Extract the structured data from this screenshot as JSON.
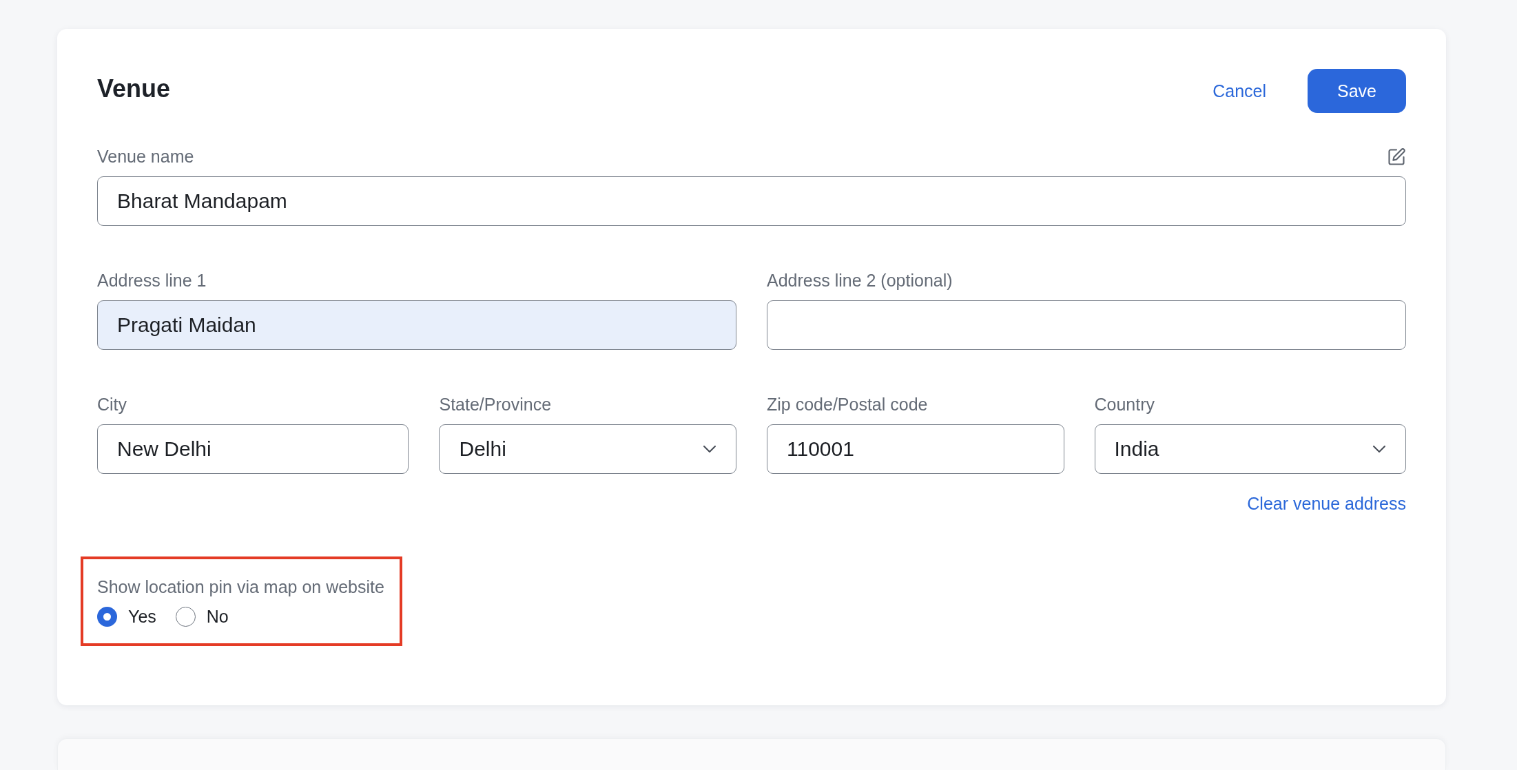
{
  "card": {
    "title": "Venue",
    "actions": [
      {
        "label": "Cancel",
        "kind": "link"
      },
      {
        "label": "Save",
        "kind": "primary"
      }
    ],
    "rows": [
      {
        "fields": [
          {
            "label": "Venue name",
            "value": "Bharat Mandapam",
            "kind": "text",
            "highlighted": false,
            "edit_icon": true
          }
        ]
      },
      {
        "fields": [
          {
            "label": "Address line 1",
            "value": "Pragati Maidan",
            "kind": "text",
            "highlighted": true
          },
          {
            "label": "Address line 2 (optional)",
            "kind": "text",
            "highlighted": false
          }
        ]
      },
      {
        "fields": [
          {
            "label": "City",
            "value": "New Delhi",
            "kind": "text",
            "highlighted": false
          },
          {
            "label": "State/Province",
            "value": "Delhi",
            "kind": "select",
            "highlighted": false
          },
          {
            "label": "Zip code/Postal code",
            "value": "110001",
            "kind": "text",
            "highlighted": false
          },
          {
            "label": "Country",
            "value": "India",
            "kind": "select",
            "highlighted": false
          }
        ]
      }
    ],
    "clear_link": "Clear venue address",
    "map_pin": {
      "label": "Show location pin via map on website",
      "annotated": true,
      "options": [
        {
          "label": "Yes",
          "selected": true
        },
        {
          "label": "No",
          "selected": false
        }
      ]
    }
  }
}
